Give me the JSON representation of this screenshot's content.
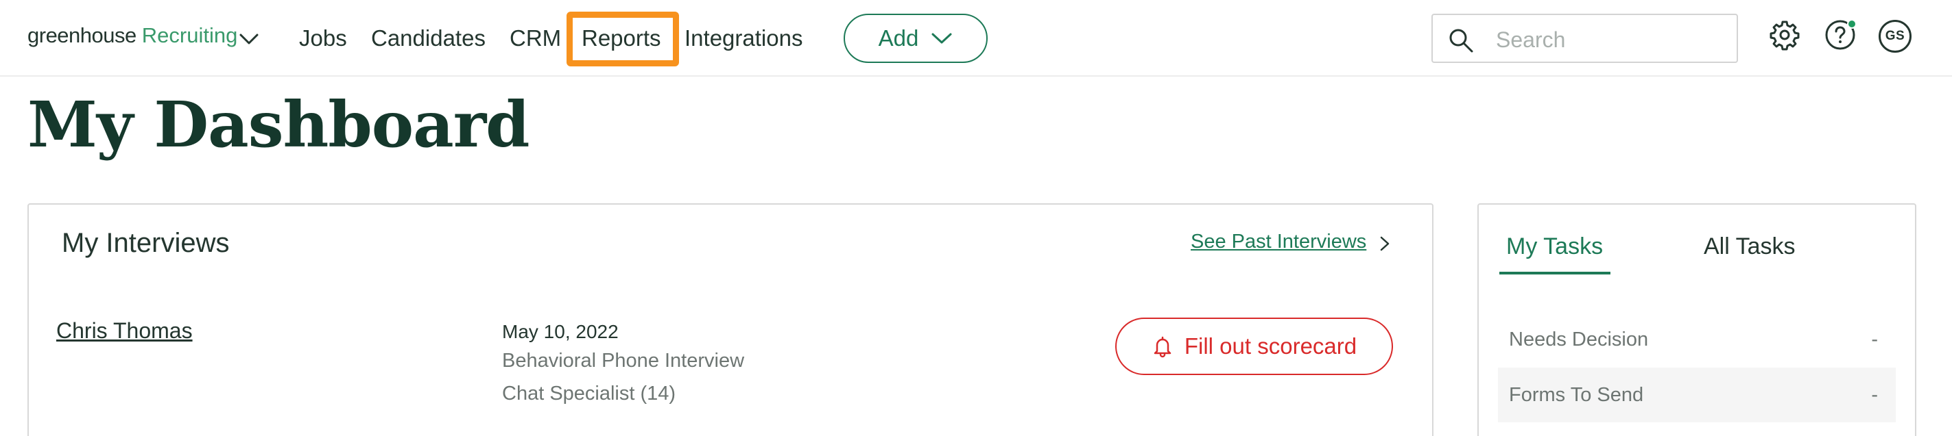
{
  "nav": {
    "brand": "greenhouse",
    "brand_product": "Recruiting",
    "items": [
      {
        "label": "Jobs"
      },
      {
        "label": "Candidates"
      },
      {
        "label": "CRM"
      },
      {
        "label": "Reports"
      },
      {
        "label": "Integrations"
      }
    ],
    "highlighted_item": "Reports",
    "highlight_color": "#f7921e",
    "add_label": "Add",
    "search_placeholder": "Search",
    "avatar_initials": "GS",
    "icons": [
      "chevron-down-icon",
      "search-icon",
      "gear-icon",
      "help-icon"
    ]
  },
  "page": {
    "title": "My Dashboard"
  },
  "interviews": {
    "title": "My Interviews",
    "past_link": "See Past Interviews",
    "rows": [
      {
        "candidate": "Chris Thomas",
        "date": "May 10, 2022",
        "interview": "Behavioral Phone Interview",
        "job": "Chat Specialist (14)",
        "action": "Fill out scorecard"
      }
    ]
  },
  "tasks": {
    "tabs": [
      {
        "label": "My Tasks",
        "active": true
      },
      {
        "label": "All Tasks",
        "active": false
      }
    ],
    "rows": [
      {
        "label": "Needs Decision",
        "value": "-"
      },
      {
        "label": "Forms To Send",
        "value": "-"
      }
    ]
  },
  "colors": {
    "brand_green": "#1d7a57",
    "danger_red": "#d92a2a",
    "text_dark": "#24362f"
  }
}
